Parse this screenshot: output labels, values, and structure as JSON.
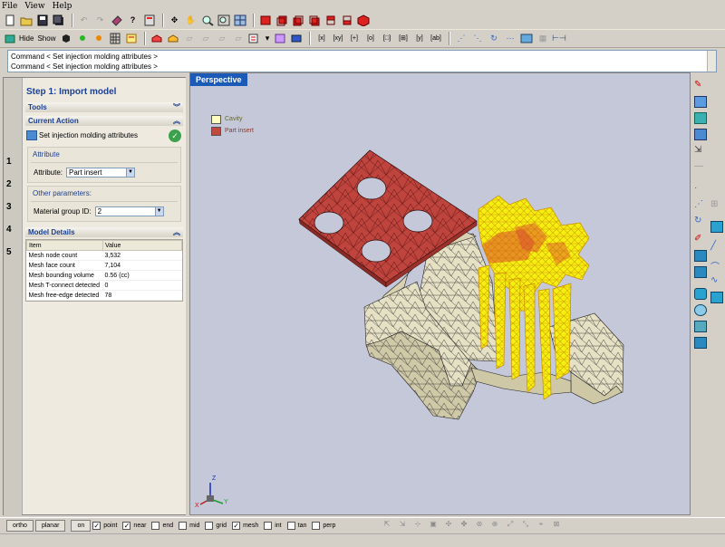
{
  "menu": {
    "file": "File",
    "view": "View",
    "help": "Help"
  },
  "toolbar2": {
    "hide_label": "Hide",
    "show_label": "Show"
  },
  "command_lines": [
    "Command < Set injection molding attributes >",
    "Command < Set injection molding attributes >"
  ],
  "step_tabs": [
    "1",
    "2",
    "3",
    "4",
    "5"
  ],
  "panel": {
    "title": "Step 1: Import model",
    "tools_label": "Tools",
    "current_action_label": "Current Action",
    "action_text": "Set injection molding attributes",
    "attribute_group": "Attribute",
    "attribute_label": "Attribute:",
    "attribute_value": "Part insert",
    "other_group": "Other parameters:",
    "material_label": "Material group ID:",
    "material_value": "2",
    "model_details_label": "Model Details"
  },
  "model_details": {
    "headers": [
      "Item",
      "Value"
    ],
    "rows": [
      [
        "Mesh node count",
        "3,532"
      ],
      [
        "Mesh face count",
        "7,104"
      ],
      [
        "Mesh bounding volume",
        "0.56 (cc)"
      ],
      [
        "Mesh T-connect detected",
        "0"
      ],
      [
        "Mesh free-edge detected",
        "78"
      ]
    ]
  },
  "viewport": {
    "tab_label": "Perspective",
    "legend": [
      {
        "label": "Cavity",
        "color": "#fffcc0"
      },
      {
        "label": "Part insert",
        "color": "#c04a40"
      }
    ],
    "axis_labels": {
      "z": "Z",
      "y": "Y",
      "x": "X"
    }
  },
  "status": {
    "ortho": "ortho",
    "planar": "planar",
    "on": "on",
    "snaps": [
      {
        "label": "point",
        "checked": true
      },
      {
        "label": "near",
        "checked": true
      },
      {
        "label": "end",
        "checked": false
      },
      {
        "label": "mid",
        "checked": false
      },
      {
        "label": "grid",
        "checked": false
      },
      {
        "label": "mesh",
        "checked": true
      },
      {
        "label": "int",
        "checked": false
      },
      {
        "label": "tan",
        "checked": false
      },
      {
        "label": "perp",
        "checked": false
      }
    ]
  },
  "colors": {
    "insert_red": "#c0443e",
    "cavity_tan": "#e8e2c8",
    "wire_yellow": "#f0ee10",
    "viewport_bg": "#c4c8d8",
    "header_blue": "#1c5ab8"
  }
}
